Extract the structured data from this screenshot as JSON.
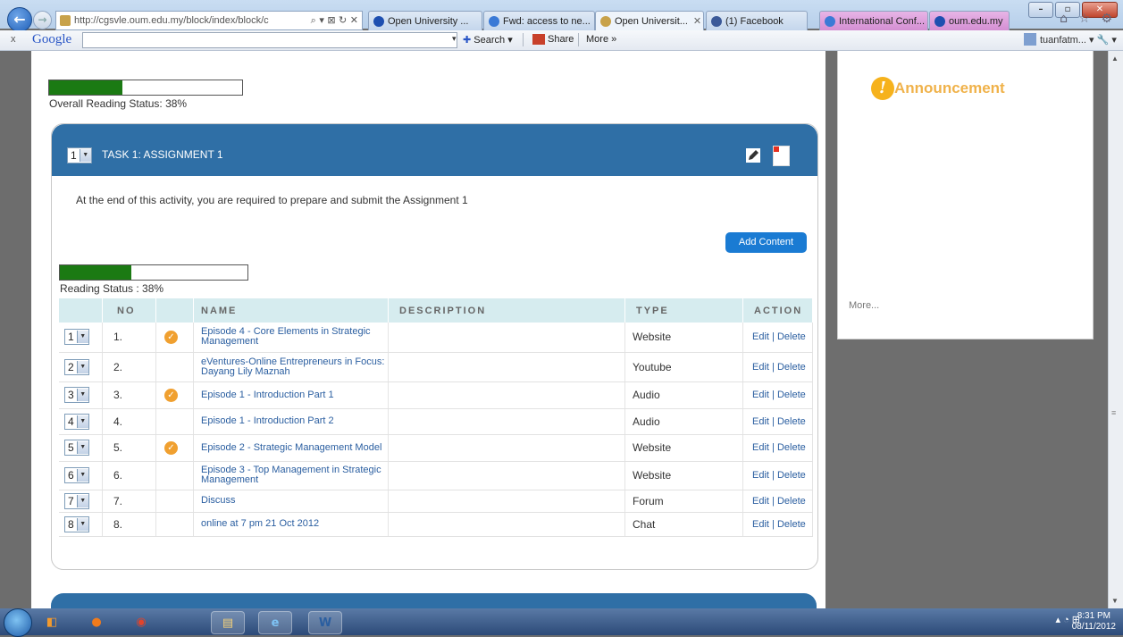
{
  "browser": {
    "url": "http://cgsvle.oum.edu.my/block/index/block/c",
    "address_tools": "⌕ ▾ ⊠ ↻ ✕",
    "tabs": [
      {
        "label": "Open University ...",
        "icon_color": "#1e4fb0"
      },
      {
        "label": "Fwd: access to ne...",
        "icon_color": "#3b7ad6"
      },
      {
        "label": "Open Universit...",
        "icon_color": "#c8a24a",
        "close": "✕"
      },
      {
        "label": "(1) Facebook",
        "icon_color": "#3b5998"
      },
      {
        "label": "International Conf...",
        "icon_color": "#3b7ad6"
      },
      {
        "label": "oum.edu.my",
        "icon_color": "#1e4fb0"
      }
    ],
    "toolbar_icons": "⌂ ☆ ⚙",
    "window_buttons": [
      "–",
      "▫",
      "✕"
    ]
  },
  "google_toolbar": {
    "close": "x",
    "logo": "Google",
    "search_dropdown": "▾",
    "search_label": "Search ▾",
    "share_label": "Share",
    "more_label": "More »",
    "user_label": "tuanfatm... ▾ 🔧 ▾"
  },
  "overall": {
    "status_label": "Overall Reading Status: 38%",
    "progress": 0.38
  },
  "task": {
    "order": "1",
    "title": "TASK 1: ASSIGNMENT 1",
    "description": "At the end of this activity, you are required to prepare and submit the Assignment 1",
    "add_content_label": "Add Content",
    "reading_status_label": "Reading Status : 38%",
    "progress": 0.38
  },
  "table": {
    "headers": [
      "",
      "NO",
      "",
      "NAME",
      "DESCRIPTION",
      "TYPE",
      "ACTION"
    ],
    "rows": [
      {
        "order": "1",
        "no": "1.",
        "read": true,
        "name": "Episode 4 - Core Elements in Strategic Management",
        "description": "",
        "type": "Website",
        "edit": "Edit",
        "delete": "Delete"
      },
      {
        "order": "2",
        "no": "2.",
        "read": false,
        "name": "eVentures-Online Entrepreneurs in Focus: Dayang Lily Maznah",
        "description": "",
        "type": "Youtube",
        "edit": "Edit",
        "delete": "Delete"
      },
      {
        "order": "3",
        "no": "3.",
        "read": true,
        "name": "Episode 1 - Introduction Part 1",
        "description": "",
        "type": "Audio",
        "edit": "Edit",
        "delete": "Delete"
      },
      {
        "order": "4",
        "no": "4.",
        "read": false,
        "name": "Episode 1 - Introduction Part 2",
        "description": "",
        "type": "Audio",
        "edit": "Edit",
        "delete": "Delete"
      },
      {
        "order": "5",
        "no": "5.",
        "read": true,
        "name": "Episode 2 - Strategic Management Model",
        "description": "",
        "type": "Website",
        "edit": "Edit",
        "delete": "Delete"
      },
      {
        "order": "6",
        "no": "6.",
        "read": false,
        "name": "Episode 3 - Top Management in Strategic Management",
        "description": "",
        "type": "Website",
        "edit": "Edit",
        "delete": "Delete"
      },
      {
        "order": "7",
        "no": "7.",
        "read": false,
        "name": "Discuss",
        "description": "",
        "type": "Forum",
        "edit": "Edit",
        "delete": "Delete"
      },
      {
        "order": "8",
        "no": "8.",
        "read": false,
        "name": "online at 7 pm 21 Oct 2012",
        "description": "",
        "type": "Chat",
        "edit": "Edit",
        "delete": "Delete"
      }
    ]
  },
  "announcement": {
    "icon": "!",
    "title": "Announcement",
    "more_label": "More..."
  },
  "taskbar": {
    "tray": "▴ ◔ ⊞",
    "time": "8:31 PM",
    "date": "08/11/2012"
  },
  "colors": {
    "header_blue": "#2f6fa6",
    "progress_green": "#1b7a13",
    "add_button": "#1a7bd3",
    "announcement_title": "#f0b24a"
  }
}
